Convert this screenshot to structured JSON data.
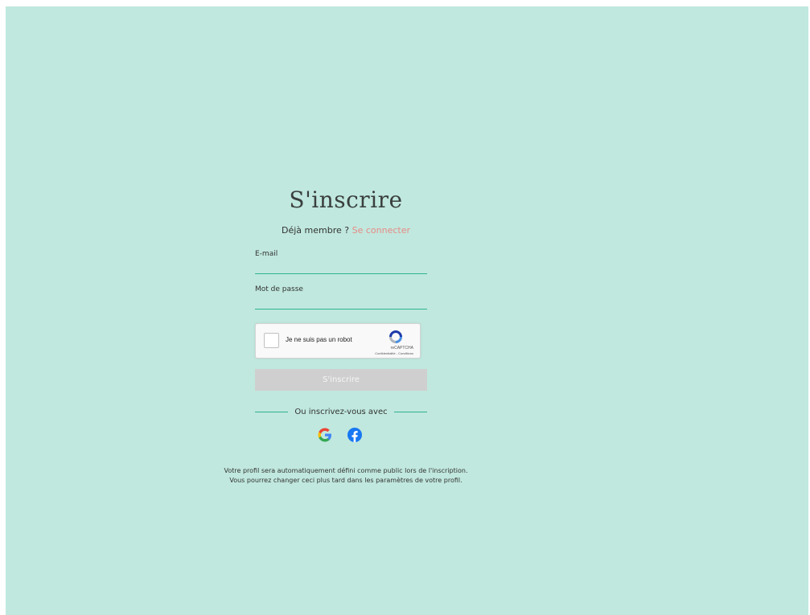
{
  "signup": {
    "title": "S'inscrire",
    "already_member": "Déjà membre ?",
    "login_link": "Se connecter",
    "email_label": "E-mail",
    "password_label": "Mot de passe",
    "submit_label": "S'inscrire",
    "divider_text": "Ou inscrivez-vous avec",
    "notice_line1": "Votre profil sera automatiquement défini comme public lors de l'inscription.",
    "notice_line2": "Vous pourrez changer ceci plus tard dans les paramètres de votre profil."
  },
  "recaptcha": {
    "label": "Je ne suis pas un robot",
    "brand": "reCAPTCHA",
    "terms": "Confidentialité - Conditions"
  },
  "social": {
    "google_icon": "google-icon",
    "facebook_icon": "facebook-icon"
  },
  "colors": {
    "background": "#c0e8de",
    "accent": "#2fb291",
    "link": "#e88a86",
    "button_disabled": "#cfcfcf"
  }
}
